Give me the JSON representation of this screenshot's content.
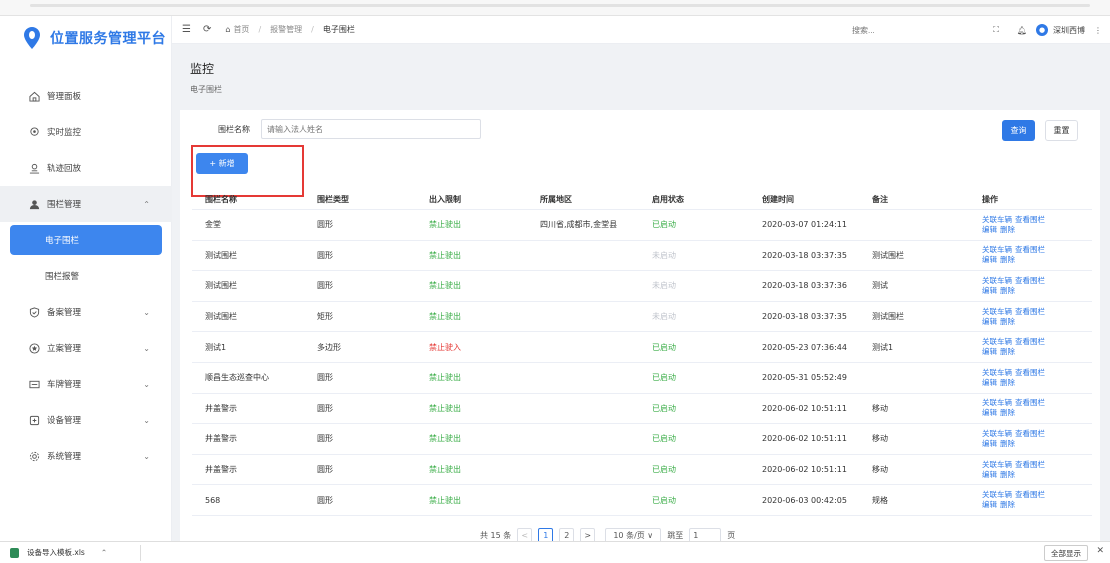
{
  "app": {
    "title": "位置服务管理平台",
    "brand_color": "#2f79e6"
  },
  "sidebar": {
    "items": [
      {
        "label": "管理面板",
        "icon": "home-icon"
      },
      {
        "label": "实时监控",
        "icon": "location-icon"
      },
      {
        "label": "轨迹回放",
        "icon": "track-icon"
      },
      {
        "label": "围栏管理",
        "icon": "fence-icon"
      },
      {
        "label": "电子围栏",
        "icon": ""
      },
      {
        "label": "围栏报警",
        "icon": ""
      },
      {
        "label": "备案管理",
        "icon": "shield-icon"
      },
      {
        "label": "立案管理",
        "icon": "star-circle-icon"
      },
      {
        "label": "车牌管理",
        "icon": "plate-icon"
      },
      {
        "label": "设备管理",
        "icon": "device-icon"
      },
      {
        "label": "系统管理",
        "icon": "gear-icon"
      }
    ]
  },
  "header": {
    "breadcrumb": [
      "首页",
      "报警管理",
      "电子围栏"
    ],
    "search_placeholder": "搜索...",
    "user": "深圳西博"
  },
  "page": {
    "title": "监控",
    "subtitle": "电子围栏"
  },
  "filter": {
    "label": "围栏名称",
    "placeholder": "请输入法人姓名",
    "query": "查询",
    "reset": "重置",
    "add": "+ 新增"
  },
  "table": {
    "headers": [
      "围栏名称",
      "围栏类型",
      "出入限制",
      "所属地区",
      "启用状态",
      "创建时间",
      "备注",
      "操作"
    ],
    "op_labels": [
      "关联车辆",
      "查看围栏",
      "编辑",
      "删除"
    ],
    "rows": [
      {
        "name": "金堂",
        "type": "圆形",
        "limit": "禁止驶出",
        "region": "四川省,成都市,金堂县",
        "status": "已启动",
        "created": "2020-03-07 01:24:11",
        "note": ""
      },
      {
        "name": "测试围栏",
        "type": "圆形",
        "limit": "禁止驶出",
        "region": "",
        "status": "未启动",
        "created": "2020-03-18 03:37:35",
        "note": "测试围栏"
      },
      {
        "name": "测试围栏",
        "type": "圆形",
        "limit": "禁止驶出",
        "region": "",
        "status": "未启动",
        "created": "2020-03-18 03:37:36",
        "note": "测试"
      },
      {
        "name": "测试围栏",
        "type": "矩形",
        "limit": "禁止驶出",
        "region": "",
        "status": "未启动",
        "created": "2020-03-18 03:37:35",
        "note": "测试围栏"
      },
      {
        "name": "测试1",
        "type": "多边形",
        "limit": "禁止驶入",
        "region": "",
        "status": "已启动",
        "created": "2020-05-23 07:36:44",
        "note": "测试1"
      },
      {
        "name": "顺昌生态巡查中心",
        "type": "圆形",
        "limit": "禁止驶出",
        "region": "",
        "status": "已启动",
        "created": "2020-05-31 05:52:49",
        "note": ""
      },
      {
        "name": "井盖警示",
        "type": "圆形",
        "limit": "禁止驶出",
        "region": "",
        "status": "已启动",
        "created": "2020-06-02 10:51:11",
        "note": "移动"
      },
      {
        "name": "井盖警示",
        "type": "圆形",
        "limit": "禁止驶出",
        "region": "",
        "status": "已启动",
        "created": "2020-06-02 10:51:11",
        "note": "移动"
      },
      {
        "name": "井盖警示",
        "type": "圆形",
        "limit": "禁止驶出",
        "region": "",
        "status": "已启动",
        "created": "2020-06-02 10:51:11",
        "note": "移动"
      },
      {
        "name": "568",
        "type": "圆形",
        "limit": "禁止驶出",
        "region": "",
        "status": "已启动",
        "created": "2020-06-03 00:42:05",
        "note": "规格"
      }
    ]
  },
  "pagination": {
    "total": "共 15 条",
    "prev": "<",
    "pages": [
      "1",
      "2"
    ],
    "next": ">",
    "page_size": "10 条/页 ∨",
    "jump_label": "跳至",
    "jump_value": "1",
    "page_suffix": "页"
  },
  "downloads": {
    "file": "设备导入模板.xls",
    "show_all": "全部显示"
  }
}
